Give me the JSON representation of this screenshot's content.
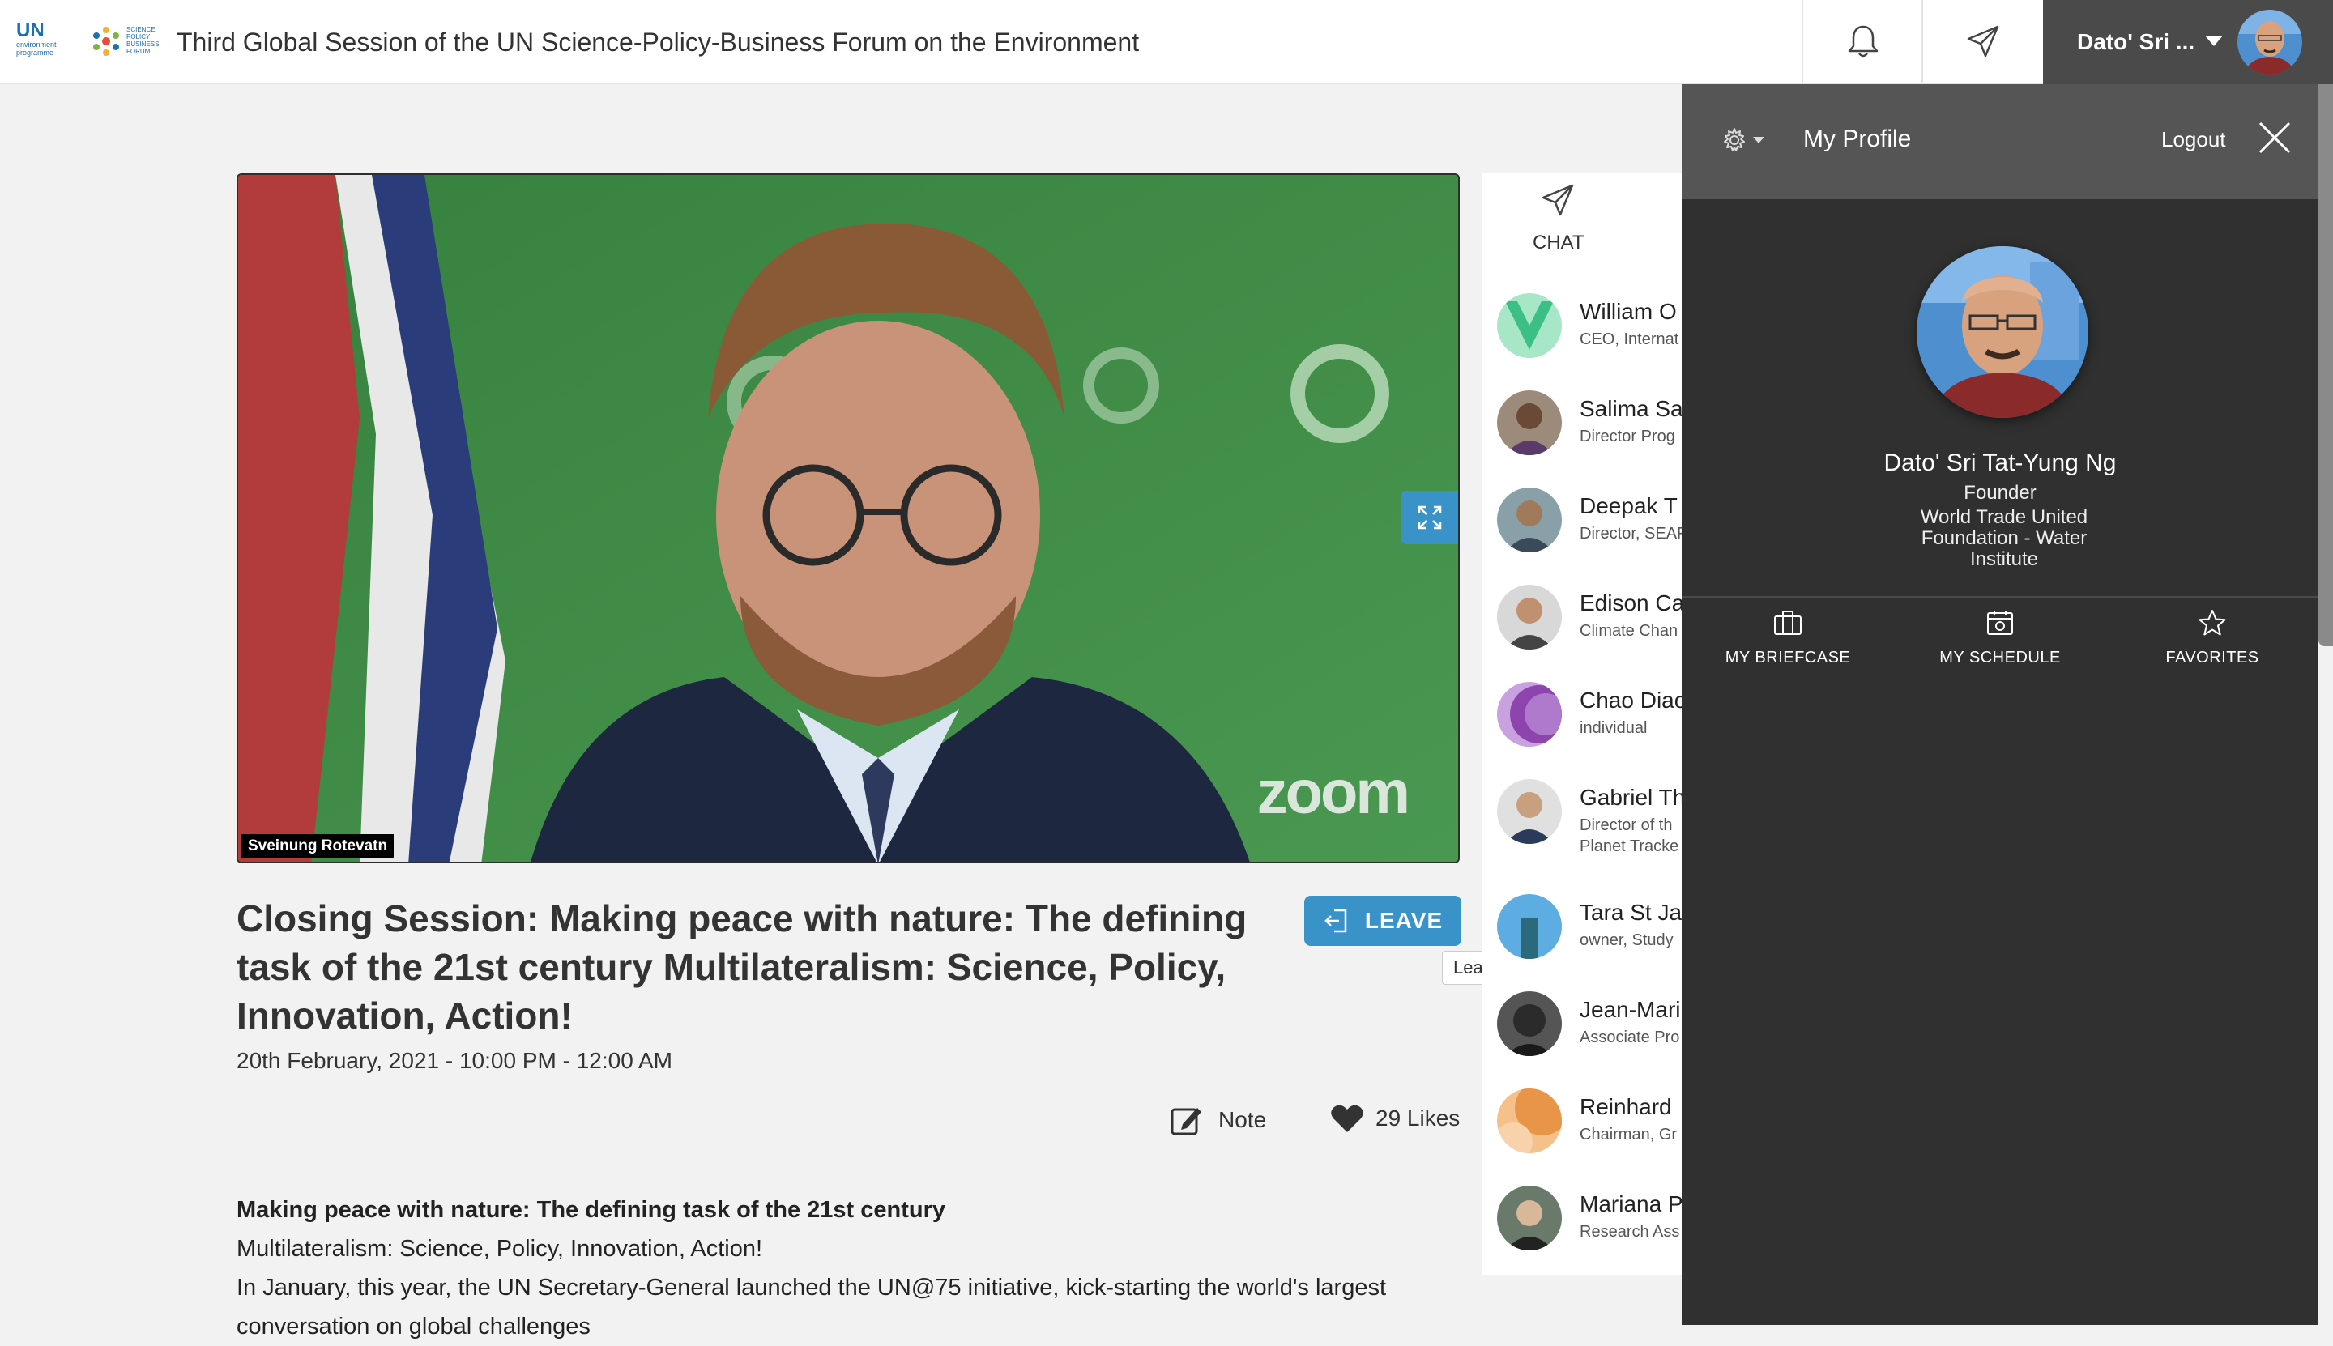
{
  "header": {
    "un_logo_text": "UN",
    "un_logo_sub": "environment programme",
    "forum_logo_text": "SCIENCE POLICY BUSINESS FORUM",
    "event_title": "Third Global Session of the UN Science-Policy-Business Forum on the Environment",
    "user_name": "Dato' Sri ...",
    "icons": [
      "bell-icon",
      "send-icon",
      "chevron-down-icon"
    ]
  },
  "video": {
    "speaker": "Sveinung Rotevatn",
    "watermark": "zoom"
  },
  "session": {
    "title": "Closing Session: Making peace with nature: The defining task of the 21st century Multilateralism: Science, Policy, Innovation, Action!",
    "date": "20th February, 2021 - 10:00 PM - 12:00 AM",
    "leave_label": "LEAVE",
    "leave_tooltip": "Leave",
    "note_label": "Note",
    "likes_label": "29 Likes"
  },
  "description": {
    "heading": "Making peace with nature: The defining task of the 21st century",
    "line1": "Multilateralism: Science, Policy, Innovation, Action!",
    "line2": "In January, this year, the UN Secretary-General launched the UN@75 initiative, kick-starting the world's largest",
    "line3": "conversation on global challenges"
  },
  "chat": {
    "tab_label": "CHAT",
    "attendees": [
      {
        "name": "William O",
        "role": "CEO, Internat",
        "color": "#67d3a4"
      },
      {
        "name": "Salima Sa",
        "role": "Director Prog",
        "color": "#7a5a48"
      },
      {
        "name": "Deepak T",
        "role": "Director, SEAF",
        "color": "#6d7d86"
      },
      {
        "name": "Edison Ca",
        "role": "Climate Chan",
        "color": "#b08a74"
      },
      {
        "name": "Chao Diao",
        "role": "individual",
        "color": "#8e44ad"
      },
      {
        "name": "Gabriel Th",
        "role": "Director of th",
        "role2": "Planet Tracke",
        "color": "#506a84"
      },
      {
        "name": "Tara St Ja",
        "role": "owner, Study",
        "color": "#5dade2"
      },
      {
        "name": "Jean-Mari",
        "role": "Associate Pro",
        "color": "#2b2b2b"
      },
      {
        "name": "Reinhard",
        "role": "Chairman, Gr",
        "color": "#e8954a"
      },
      {
        "name": "Mariana P",
        "role": "Research Ass",
        "color": "#3a4a3a"
      }
    ]
  },
  "profile": {
    "panel_title": "My Profile",
    "logout_label": "Logout",
    "name": "Dato' Sri Tat-Yung Ng",
    "role": "Founder",
    "organization": "World Trade United Foundation - Water Institute",
    "actions": [
      {
        "label": "MY BRIEFCASE",
        "icon": "briefcase-icon"
      },
      {
        "label": "MY SCHEDULE",
        "icon": "calendar-icon"
      },
      {
        "label": "FAVORITES",
        "icon": "star-icon"
      }
    ]
  },
  "colors": {
    "accent": "#3a93c8",
    "user_tab": "#4a4a4a",
    "profile_bg": "#303030",
    "profile_header": "#555555"
  }
}
